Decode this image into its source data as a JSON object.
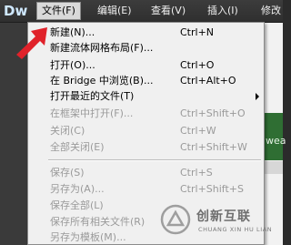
{
  "app": {
    "logo": "Dw"
  },
  "menubar": [
    {
      "label": "文件(F)",
      "active": true
    },
    {
      "label": "编辑(E)"
    },
    {
      "label": "查看(V)"
    },
    {
      "label": "插入(I)"
    },
    {
      "label": "修改"
    }
  ],
  "side_panel": {
    "text": "wea"
  },
  "file_menu": [
    {
      "label": "新建(N)...",
      "shortcut": "Ctrl+N",
      "enabled": true
    },
    {
      "label": "新建流体网格布局(F)...",
      "shortcut": "",
      "enabled": true
    },
    {
      "label": "打开(O)...",
      "shortcut": "Ctrl+O",
      "enabled": true
    },
    {
      "label": "在 Bridge 中浏览(B)...",
      "shortcut": "Ctrl+Alt+O",
      "enabled": true
    },
    {
      "label": "打开最近的文件(T)",
      "shortcut": "",
      "enabled": true,
      "submenu": true
    },
    {
      "label": "在框架中打开(F)...",
      "shortcut": "Ctrl+Shift+O",
      "enabled": false
    },
    {
      "label": "关闭(C)",
      "shortcut": "Ctrl+W",
      "enabled": false
    },
    {
      "label": "全部关闭(E)",
      "shortcut": "Ctrl+Shift+W",
      "enabled": false
    },
    {
      "label": "保存(S)",
      "shortcut": "Ctrl+S",
      "enabled": false
    },
    {
      "label": "另存为(A)...",
      "shortcut": "Ctrl+Shift+S",
      "enabled": false
    },
    {
      "label": "保存全部(L)",
      "shortcut": "",
      "enabled": false
    },
    {
      "label": "保存所有相关文件(R)",
      "shortcut": "",
      "enabled": false
    },
    {
      "label": "另存为模板(M)...",
      "shortcut": "",
      "enabled": false
    }
  ],
  "watermark": {
    "text_cn": "创新互联",
    "text_en": "CHUANG XIN HU LIAN"
  },
  "colors": {
    "menu_bg": "#f0f0f0",
    "disabled_text": "#9a9a9a",
    "accent_red": "#e0222a",
    "panel_green": "#2f6e33"
  }
}
